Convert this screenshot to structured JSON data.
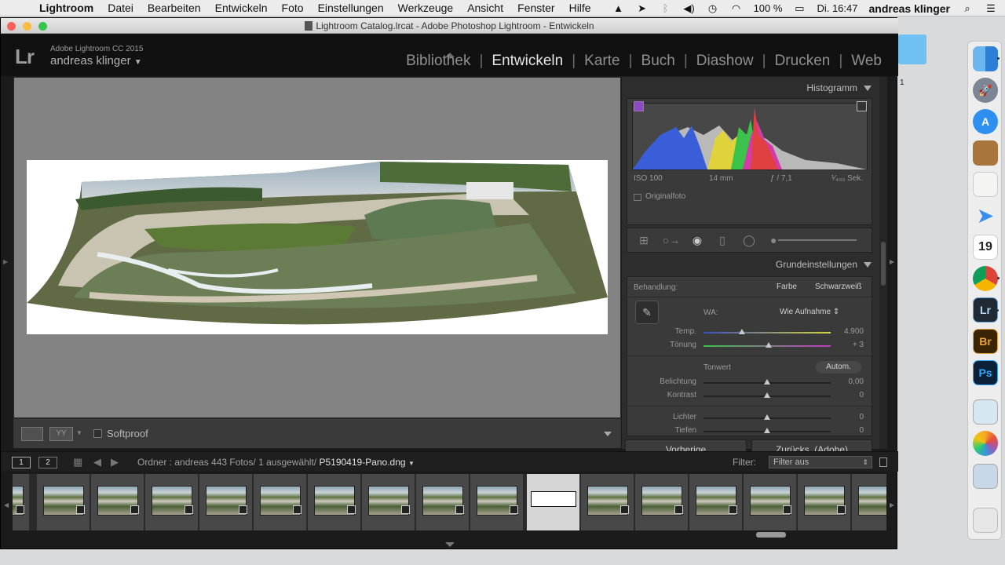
{
  "menubar": {
    "app_name": "Lightroom",
    "items": [
      "Datei",
      "Bearbeiten",
      "Entwickeln",
      "Foto",
      "Einstellungen",
      "Werkzeuge",
      "Ansicht",
      "Fenster",
      "Hilfe"
    ],
    "battery": "100 %",
    "clock": "Di. 16:47",
    "user": "andreas klinger"
  },
  "window": {
    "title": "Lightroom Catalog.lrcat - Adobe Photoshop Lightroom - Entwickeln"
  },
  "identity": {
    "logo": "Lr",
    "product": "Adobe Lightroom CC 2015",
    "user": "andreas klinger",
    "user_caret": "▼"
  },
  "modules": [
    "Bibliothek",
    "Entwickeln",
    "Karte",
    "Buch",
    "Diashow",
    "Drucken",
    "Web"
  ],
  "active_module": "Entwickeln",
  "toolbar": {
    "softproof_label": "Softproof"
  },
  "histogram": {
    "header": "Histogramm",
    "iso": "ISO 100",
    "focal": "14 mm",
    "aperture": "ƒ / 7,1",
    "shutter": "¹⁄₄₀₀ Sek.",
    "original_label": "Originalfoto"
  },
  "basic": {
    "header": "Grundeinstellungen",
    "treatment_label": "Behandlung:",
    "treatment_color": "Farbe",
    "treatment_bw": "Schwarzweiß",
    "wb_label": "WA:",
    "wb_value": "Wie Aufnahme",
    "temp_label": "Temp.",
    "temp_value": "4.900",
    "tint_label": "Tönung",
    "tint_value": "+ 3",
    "tone_label": "Tonwert",
    "auto_label": "Autom.",
    "exposure_label": "Belichtung",
    "exposure_value": "0,00",
    "contrast_label": "Kontrast",
    "contrast_value": "0",
    "highlights_label": "Lichter",
    "highlights_value": "0",
    "shadows_label": "Tiefen",
    "shadows_value": "0"
  },
  "buttons": {
    "previous": "Vorherige",
    "reset": "Zurücks. (Adobe)"
  },
  "filmstrip": {
    "screen1": "1",
    "screen2": "2",
    "crumb": "Ordner : andreas   443 Fotos/ 1 ausgewählt/",
    "filename": "P5190419-Pano.dng",
    "filter_label": "Filter:",
    "filter_value": "Filter aus"
  },
  "desktop": {
    "label": "1"
  }
}
